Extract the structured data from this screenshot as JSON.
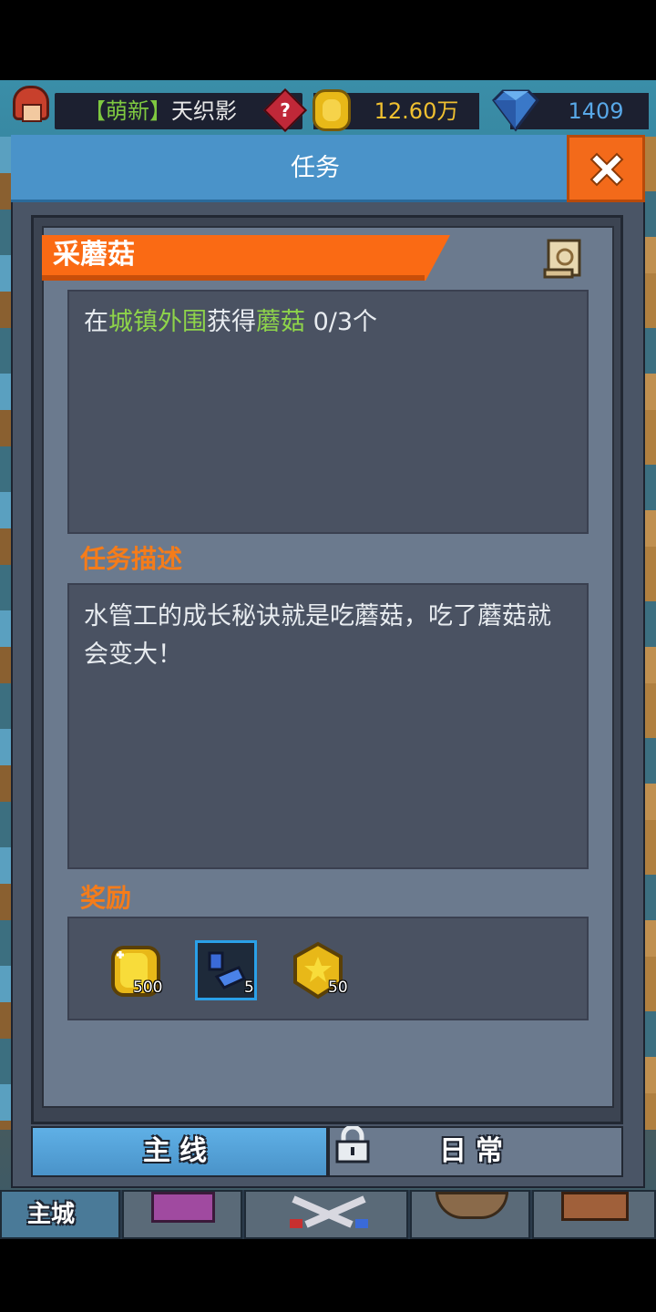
{
  "topbar": {
    "player_tag": "【萌新】",
    "player_name": "天织影",
    "help_icon": "help-diamond-icon",
    "gold": "12.60万",
    "gems": "1409"
  },
  "modal": {
    "title": "任务",
    "close_icon": "close-x-icon"
  },
  "quest": {
    "title": "采蘑菇",
    "objective": {
      "prefix": "在",
      "location": "城镇外围",
      "middle": "获得",
      "item": "蘑菇",
      "progress": " 0/3个"
    },
    "description_label": "任务描述",
    "description": "水管工的成长秘诀就是吃蘑菇，吃了蘑菇就会变大！",
    "reward_label": "奖励",
    "rewards": [
      {
        "icon": "gold-coin-icon",
        "count": "500"
      },
      {
        "icon": "blue-item-icon",
        "count": "5"
      },
      {
        "icon": "star-coin-icon",
        "count": "50"
      }
    ],
    "colors": {
      "highlight": "#8ed44a",
      "section": "#f57c1a",
      "banner": "#fa6a14"
    }
  },
  "tabs": {
    "main": "主线",
    "daily": "日常"
  },
  "bottom_nav": {
    "home": "主城"
  }
}
